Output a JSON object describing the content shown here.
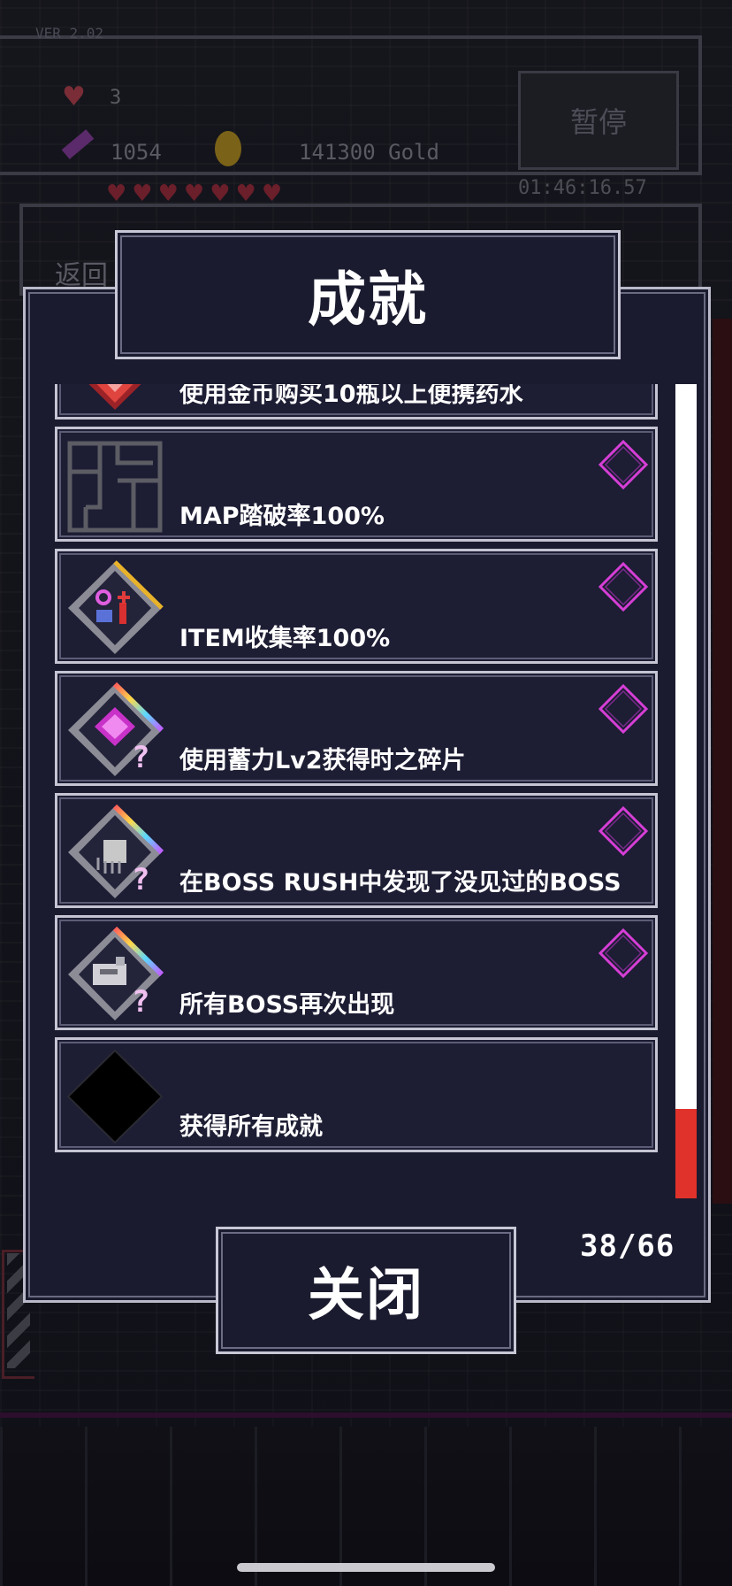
{
  "background": {
    "version": "VER 2.02",
    "hearts": "3",
    "crystals": "1054",
    "gold": "141300 Gold",
    "timer": "01:46:16.57",
    "pause_label": "暂停",
    "back_label": "返回"
  },
  "dialog": {
    "title": "成就",
    "close_label": "关闭",
    "counter": "38/66"
  },
  "achievements": [
    {
      "label": "使用金币购买10瓶以上便携药水",
      "icon": "heart-potion-icon",
      "status": "locked-diamond-icon"
    },
    {
      "label": "MAP踏破率100%",
      "icon": "map-icon",
      "status": "locked-diamond-icon"
    },
    {
      "label": "ITEM收集率100%",
      "icon": "item-collection-icon",
      "status": "locked-diamond-icon"
    },
    {
      "label": "使用蓄力Lv2获得时之碎片",
      "icon": "time-shard-icon",
      "status": "locked-diamond-icon"
    },
    {
      "label": "在BOSS RUSH中发现了没见过的BOSS",
      "icon": "boss-rush-icon",
      "status": "locked-diamond-icon"
    },
    {
      "label": "所有BOSS再次出现",
      "icon": "boss-return-icon",
      "status": "locked-diamond-icon"
    },
    {
      "label": "获得所有成就",
      "icon": "black-diamond-icon",
      "status": "none"
    }
  ],
  "scroll": {
    "position_fraction": 0.9,
    "thumb_fraction": 0.11
  },
  "colors": {
    "panel_bg": "#1b1b30",
    "border": "#c4c4d3",
    "accent_pink": "#d63ed6",
    "scroll_thumb": "#e0322a"
  }
}
